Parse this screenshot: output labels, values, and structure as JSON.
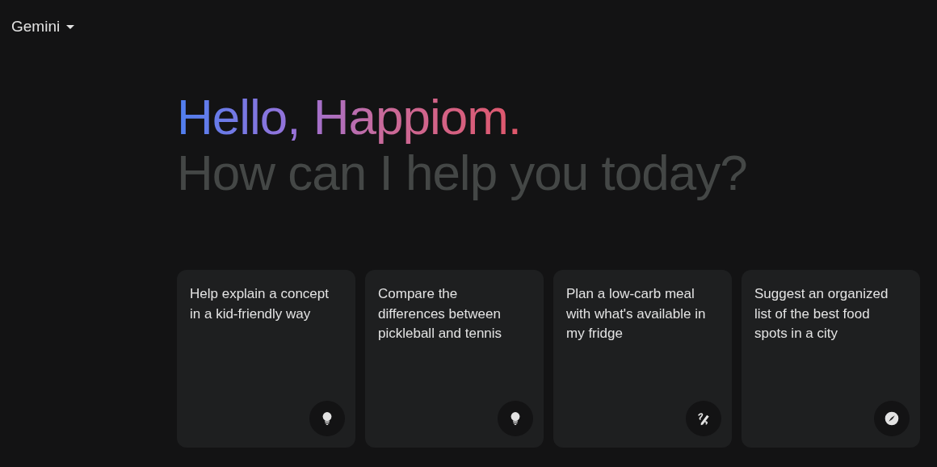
{
  "header": {
    "title": "Gemini"
  },
  "greeting": {
    "title": "Hello, Happiom.",
    "subtitle": "How can I help you today?"
  },
  "suggestions": [
    {
      "text": "Help explain a concept in a kid-friendly way",
      "kind": "bulb"
    },
    {
      "text": "Compare the differences between pickleball and tennis",
      "kind": "bulb"
    },
    {
      "text": "Plan a low-carb meal with what's available in my fridge",
      "kind": "pen"
    },
    {
      "text": "Suggest an organized list of the best food spots in a city",
      "kind": "compass"
    }
  ]
}
